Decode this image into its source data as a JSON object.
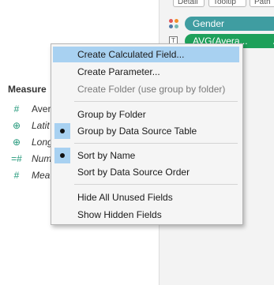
{
  "shelf_buttons": [
    "Detail",
    "Tooltip",
    "Path"
  ],
  "marks": {
    "gender_pill": {
      "label": "Gender",
      "color": "#3f9da1"
    },
    "avg_pill": {
      "label": "AVG(Avera...",
      "delta_symbol": "Δ",
      "color": "#1ea05a"
    },
    "color_dots": [
      "#e15759",
      "#f28e2b",
      "#4e79a7",
      "#76b7b2"
    ]
  },
  "measures": {
    "title": "Measure",
    "fields": [
      {
        "label": "Aver",
        "icon": "#",
        "italic": false
      },
      {
        "label": "Latit",
        "icon": "⊕",
        "italic": true
      },
      {
        "label": "Long",
        "icon": "⊕",
        "italic": true
      },
      {
        "label": "Num",
        "icon": "=#",
        "italic": true
      },
      {
        "label": "Mea",
        "icon": "#",
        "italic": true
      }
    ]
  },
  "context_menu": {
    "items": {
      "create_calculated_field": "Create Calculated Field...",
      "create_parameter": "Create Parameter...",
      "create_folder": "Create Folder (use group by folder)",
      "group_by_folder": "Group by Folder",
      "group_by_data_source_table": "Group by Data Source Table",
      "sort_by_name": "Sort by Name",
      "sort_by_data_source_order": "Sort by Data Source Order",
      "hide_all_unused_fields": "Hide All Unused Fields",
      "show_hidden_fields": "Show Hidden Fields"
    },
    "checked": [
      "group_by_data_source_table",
      "sort_by_name"
    ],
    "disabled": [
      "create_folder"
    ],
    "highlighted": "create_calculated_field",
    "highlight_color": "#a8d1f1"
  }
}
